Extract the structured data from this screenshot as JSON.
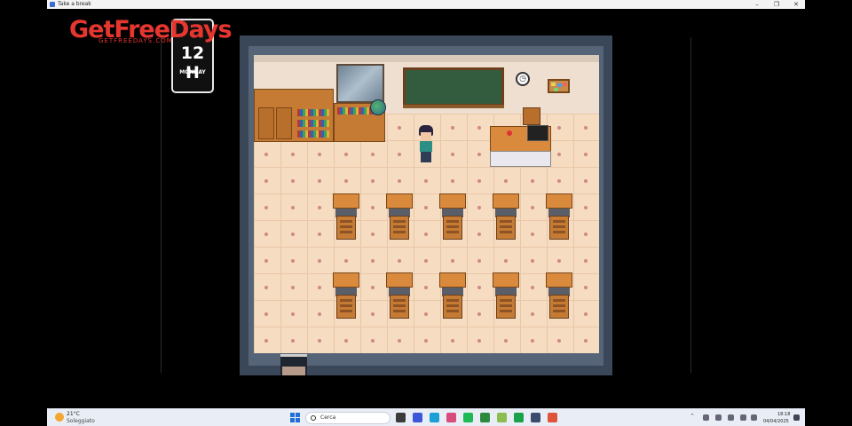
{
  "window": {
    "title": "Take a break",
    "controls": [
      "–",
      "❐",
      "✕"
    ]
  },
  "watermark": {
    "text": "GetFreeDays",
    "sub": "GETFREEDAYS.COM"
  },
  "hud": {
    "hour": "12 H",
    "day": "MONDAY"
  },
  "taskbar": {
    "weather_temp": "21°C",
    "weather_cond": "Soleggiato",
    "search_placeholder": "Cerca",
    "time": "18:18",
    "date": "04/04/2025",
    "apps": [
      {
        "name": "file-explorer-icon",
        "color": "#3b3b3b"
      },
      {
        "name": "browser-icon",
        "color": "#3c57d8"
      },
      {
        "name": "edge-icon",
        "color": "#1d9fd8"
      },
      {
        "name": "chat-icon",
        "color": "#d84b7a"
      },
      {
        "name": "spotify-icon",
        "color": "#1db954"
      },
      {
        "name": "xbox-icon",
        "color": "#2b8a3e"
      },
      {
        "name": "game-app-icon",
        "color": "#8bbd4f"
      },
      {
        "name": "sync-icon",
        "color": "#1aa14a"
      },
      {
        "name": "active-game-icon",
        "color": "#3a4c6e"
      },
      {
        "name": "snipping-icon",
        "color": "#e0533a"
      }
    ]
  },
  "colors": {
    "accent": "#e5362f",
    "floor": "#f6dcc0",
    "wall_frame": "#3a4758"
  }
}
